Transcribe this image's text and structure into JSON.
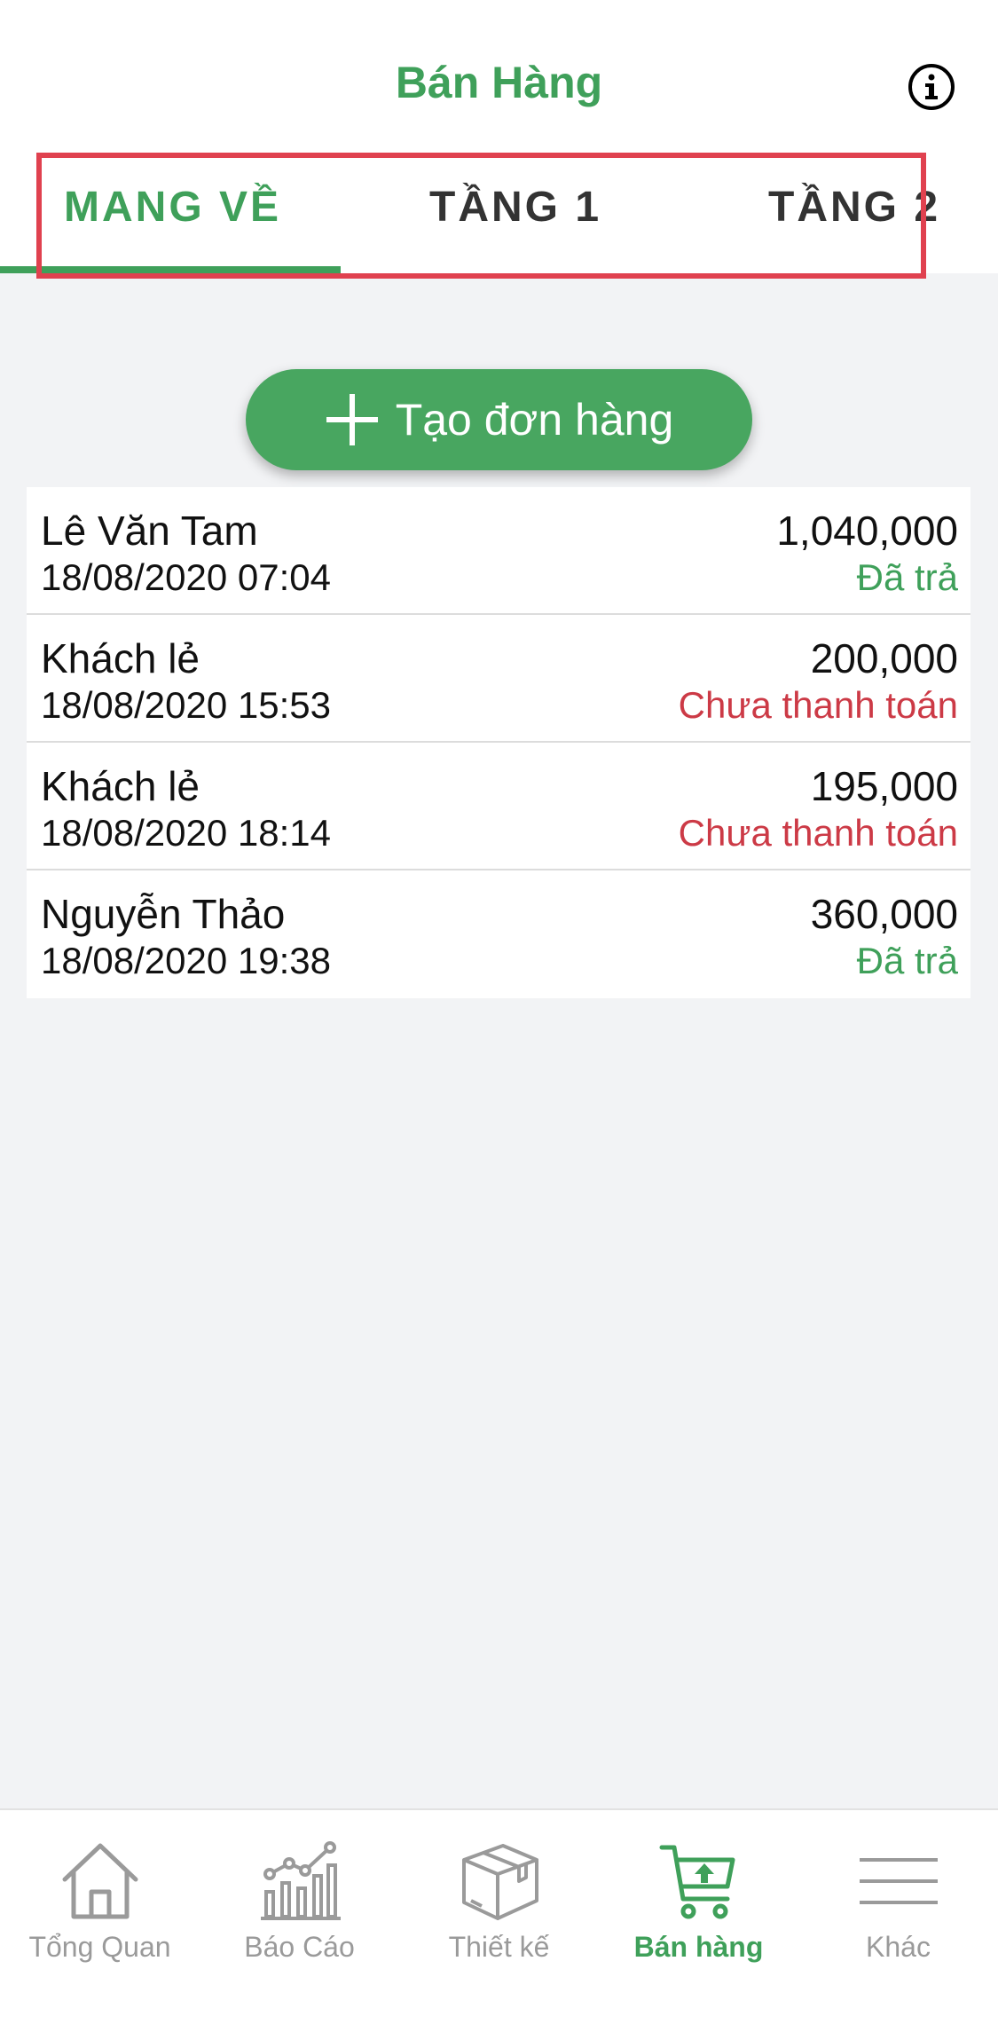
{
  "header": {
    "title": "Bán Hàng",
    "info_icon": "info-icon"
  },
  "tabs": [
    {
      "label": "MANG VỀ",
      "active": true
    },
    {
      "label": "TẦNG 1",
      "active": false
    },
    {
      "label": "TẦNG 2",
      "active": false
    }
  ],
  "create_order": {
    "label": "Tạo đơn hàng",
    "icon": "plus-icon"
  },
  "orders": [
    {
      "name": "Lê Văn Tam",
      "datetime": "18/08/2020 07:04",
      "amount": "1,040,000",
      "status": "Đã trả"
    },
    {
      "name": "Khách lẻ",
      "datetime": "18/08/2020 15:53",
      "amount": "200,000",
      "status": "Chưa thanh toán"
    },
    {
      "name": "Khách lẻ",
      "datetime": "18/08/2020 18:14",
      "amount": "195,000",
      "status": "Chưa thanh toán"
    },
    {
      "name": "Nguyễn Thảo",
      "datetime": "18/08/2020 19:38",
      "amount": "360,000",
      "status": "Đã trả"
    }
  ],
  "tabbar": [
    {
      "label": "Tổng Quan",
      "icon": "home-icon"
    },
    {
      "label": "Báo Cáo",
      "icon": "chart-icon"
    },
    {
      "label": "Thiết kế",
      "icon": "box-icon"
    },
    {
      "label": "Bán hàng",
      "icon": "cart-icon",
      "active": true
    },
    {
      "label": "Khác",
      "icon": "menu-icon"
    }
  ],
  "colors": {
    "accent": "#3fa05a",
    "button": "#48a660",
    "unpaid": "#cc3a46",
    "highlight": "#e0414f",
    "inactive": "#9a9a9a"
  }
}
